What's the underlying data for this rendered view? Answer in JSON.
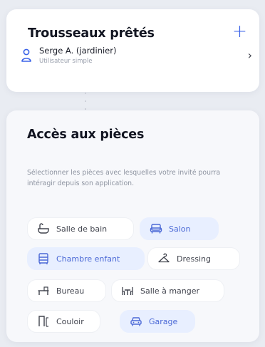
{
  "loans": {
    "title": "Trousseaux prêtés",
    "add_icon": "plus-icon",
    "user": {
      "name": "Serge A. (jardinier)",
      "role": "Utilisateur simple",
      "icon": "user-icon",
      "action_icon": "chevron-right-icon"
    }
  },
  "rooms": {
    "title": "Accès aux pièces",
    "description": "Sélectionner les pièces avec lesquelles votre invité pourra intéragir depuis son application.",
    "chips": [
      {
        "label": "Salle de bain",
        "icon": "bathtub-icon",
        "selected": false
      },
      {
        "label": "Salon",
        "icon": "sofa-icon",
        "selected": true
      },
      {
        "label": "Chambre enfant",
        "icon": "crib-icon",
        "selected": true
      },
      {
        "label": "Dressing",
        "icon": "hanger-icon",
        "selected": false
      },
      {
        "label": "Bureau",
        "icon": "desk-icon",
        "selected": false
      },
      {
        "label": "Salle à manger",
        "icon": "dining-table-icon",
        "selected": false
      },
      {
        "label": "Couloir",
        "icon": "door-icon",
        "selected": false
      },
      {
        "label": "Garage",
        "icon": "car-icon",
        "selected": true
      }
    ]
  },
  "colors": {
    "accent": "#3b63e8",
    "selected_bg": "#e8efff",
    "selected_text": "#4a68d6"
  }
}
